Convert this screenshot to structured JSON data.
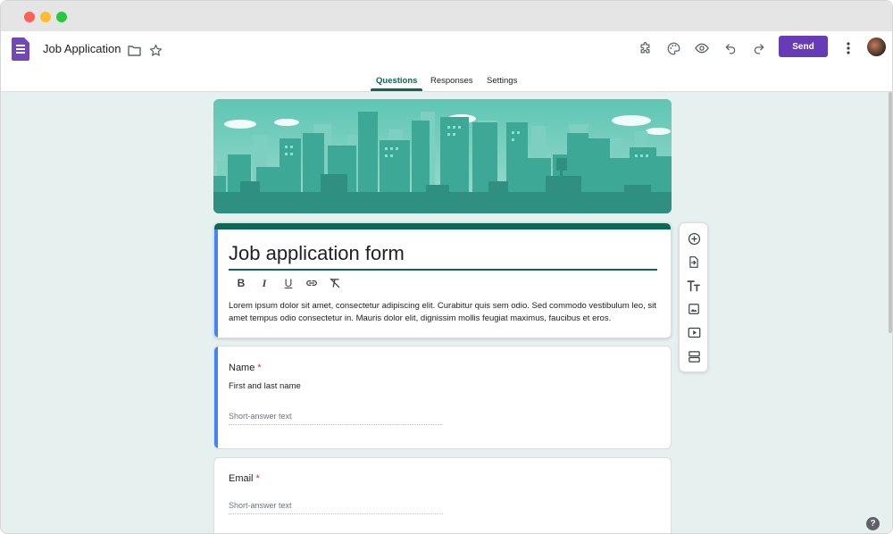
{
  "app": {
    "doc_title": "Job Application",
    "send_label": "Send"
  },
  "tabs": [
    {
      "label": "Questions",
      "active": true
    },
    {
      "label": "Responses",
      "active": false
    },
    {
      "label": "Settings",
      "active": false
    }
  ],
  "theme": {
    "accent": "#0e6654",
    "send_button": "#673ab7",
    "background": "#e6f0ee",
    "focus_bar": "#4285f4",
    "required": "#d93025"
  },
  "form": {
    "title": "Job application form",
    "description": "Lorem ipsum dolor sit amet, consectetur adipiscing elit. Curabitur quis sem odio. Sed commodo vestibulum leo, sit amet tempus odio consectetur in. Mauris dolor elit, dignissim mollis feugiat maximus, faucibus et eros.",
    "format_tools": [
      "B",
      "I",
      "U",
      "link-icon",
      "clear-format-icon"
    ]
  },
  "questions": [
    {
      "label": "Name",
      "required_mark": "*",
      "description": "First and last name",
      "placeholder": "Short-answer text"
    },
    {
      "label": "Email",
      "required_mark": "*",
      "placeholder": "Short-answer text"
    }
  ],
  "side_toolbar": [
    "add-question-icon",
    "import-questions-icon",
    "add-title-icon",
    "add-image-icon",
    "add-video-icon",
    "add-section-icon"
  ],
  "help_label": "?"
}
